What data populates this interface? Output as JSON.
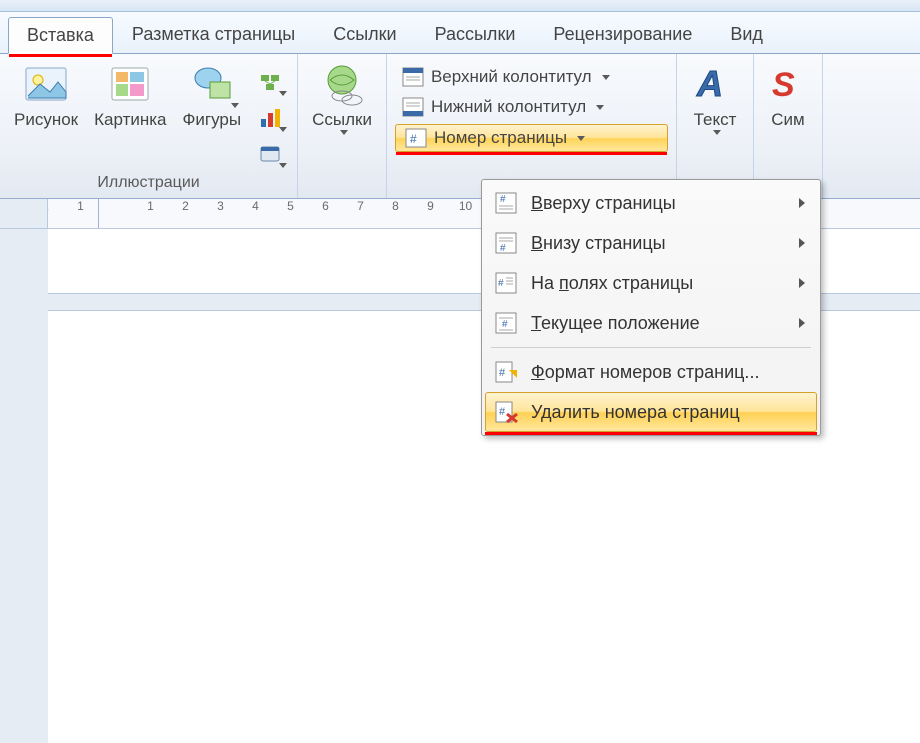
{
  "tabs": {
    "insert": "Вставка",
    "layout": "Разметка страницы",
    "refs": "Ссылки",
    "mail": "Рассылки",
    "review": "Рецензирование",
    "view": "Вид"
  },
  "ribbon": {
    "illus": {
      "picture": "Рисунок",
      "clipart": "Картинка",
      "shapes": "Фигуры",
      "group": "Иллюстрации"
    },
    "links": {
      "label": "Ссылки"
    },
    "headerfooter": {
      "header": "Верхний колонтитул",
      "footer": "Нижний колонтитул",
      "pagenum": "Номер страницы"
    },
    "text": {
      "label": "Текст"
    },
    "symbols": {
      "label": "Сим"
    }
  },
  "menu": {
    "top": "Вверху страницы",
    "bottom": "Внизу страницы",
    "margins": "На полях страницы",
    "current": "Текущее положение",
    "format": "Формат номеров страниц...",
    "remove": "Удалить номера страниц"
  }
}
